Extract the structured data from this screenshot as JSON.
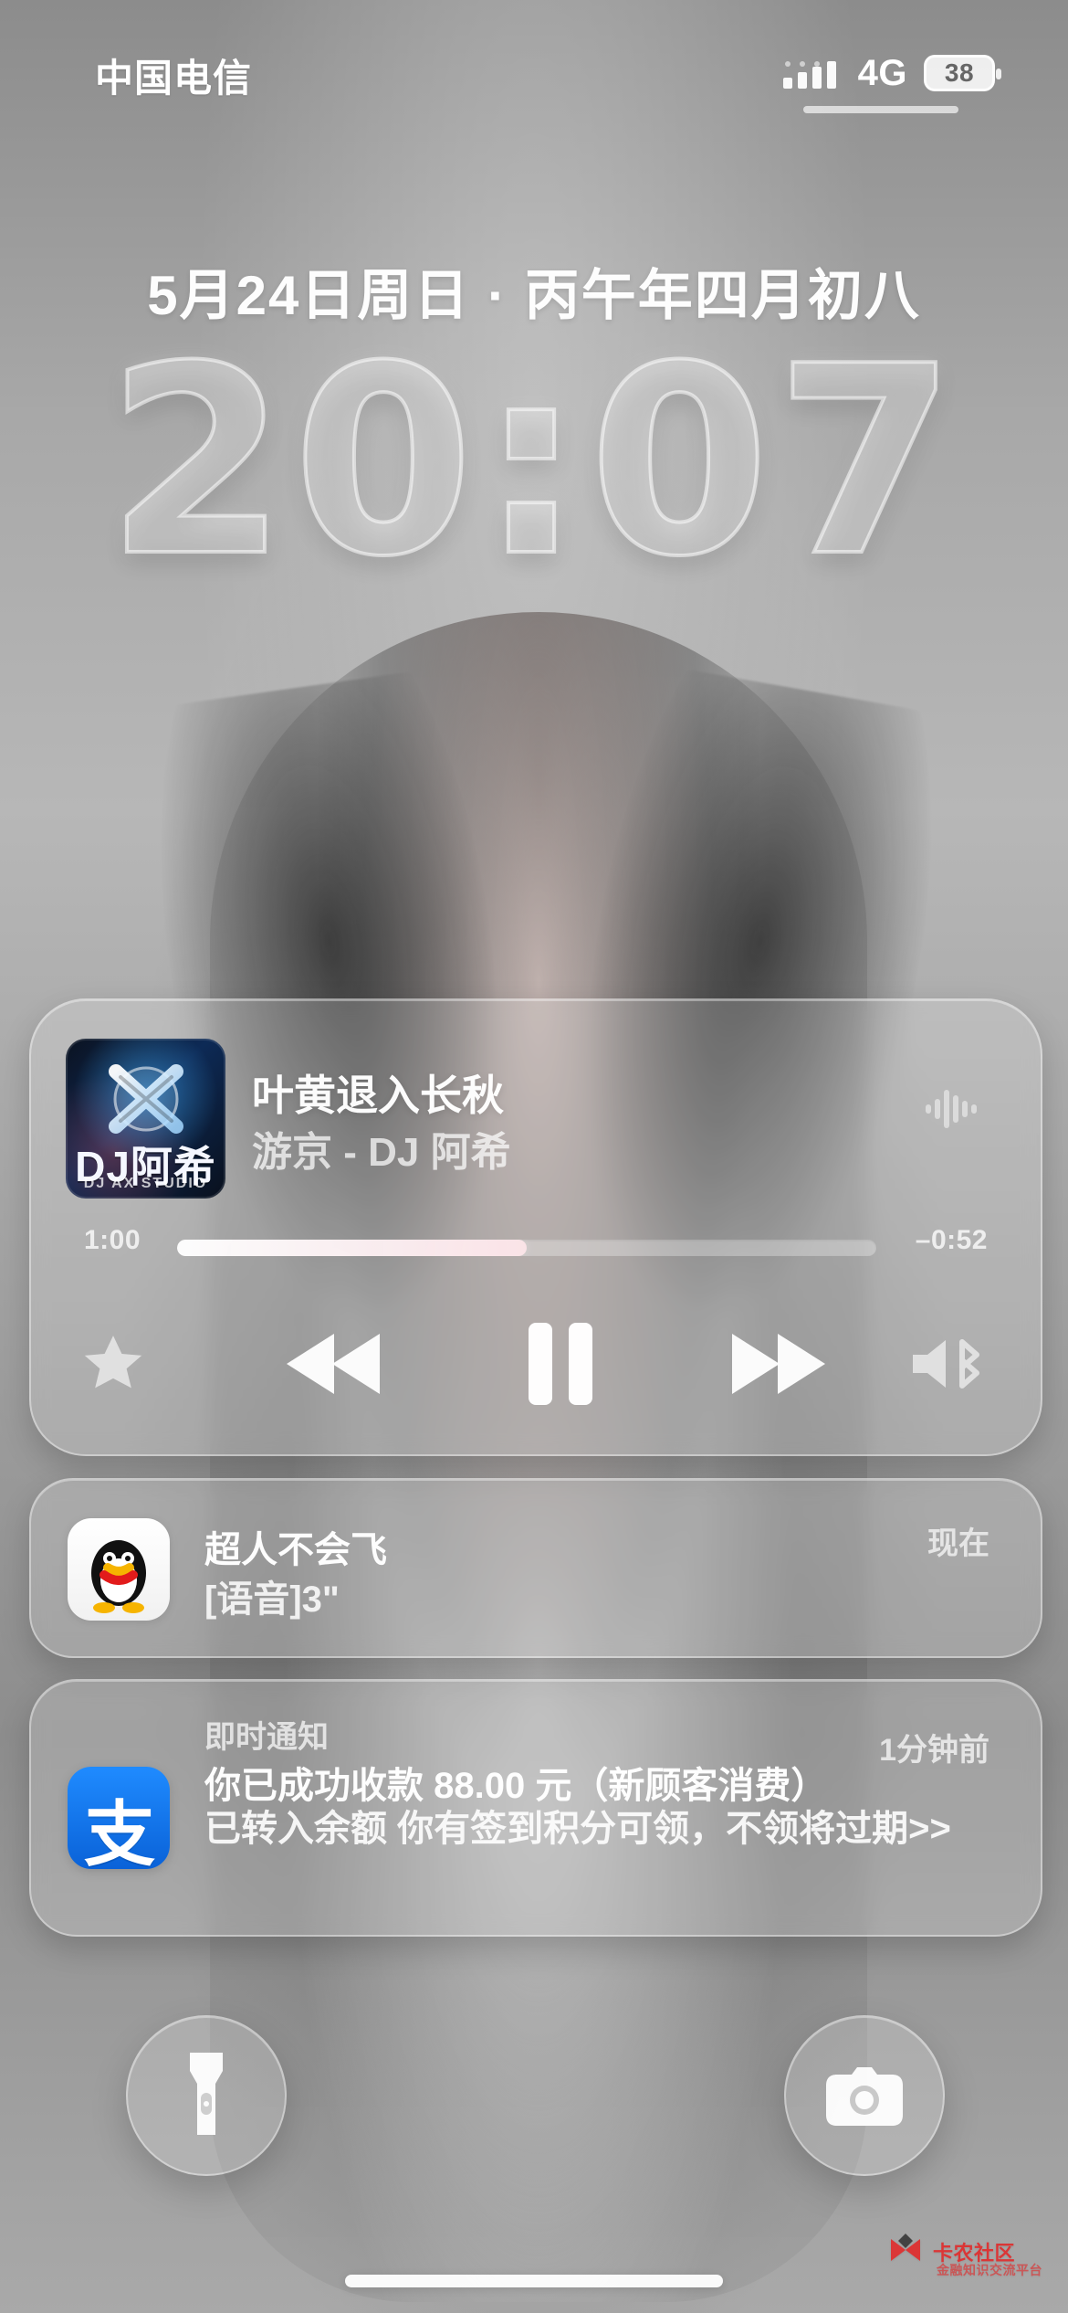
{
  "status_bar": {
    "carrier": "中国电信",
    "network": "4G",
    "battery_text": "38",
    "icons": {
      "signal": "cellular-signal-icon",
      "battery": "battery-icon"
    }
  },
  "lock_screen": {
    "date_line": "5月24日周日 · 丙午年四月初八",
    "time": "20:07"
  },
  "now_playing": {
    "album_art": {
      "text": "DJ阿希",
      "subtext": "DJ AX STUDIO",
      "icon": "album-art-icon"
    },
    "title": "叶黄退入长秋",
    "subtitle": "游京 - DJ 阿希",
    "elapsed": "1:00",
    "remaining": "–0:52",
    "progress_fraction": 0.5,
    "icons": {
      "waveform": "waveform-icon",
      "favorite": "star-icon",
      "rewind": "rewind-icon",
      "pause": "pause-icon",
      "fast_forward": "fast-forward-icon",
      "audio_output": "speaker-bluetooth-icon"
    }
  },
  "notifications": [
    {
      "app": "QQ",
      "app_icon": "qq-penguin-icon",
      "title": "超人不会飞",
      "body": "[语音]3\"",
      "time": "现在"
    },
    {
      "app": "支付宝",
      "app_icon": "alipay-icon",
      "header": "即时通知",
      "title": "你已成功收款 88.00 元（新顾客消费）",
      "body": "已转入余额 你有签到积分可领，不领将过期>>",
      "time": "1分钟前",
      "glyph": "支"
    }
  ],
  "bottom_controls": {
    "flashlight_icon": "flashlight-icon",
    "camera_icon": "camera-icon"
  },
  "watermark": {
    "text": "卡农社区",
    "subtext": "金融知识交流平台",
    "icon": "kanong-logo-icon"
  },
  "colors": {
    "accent_white": "#ffffff",
    "alipay_blue": "#0a62d8",
    "watermark_red": "#e12b2b"
  }
}
